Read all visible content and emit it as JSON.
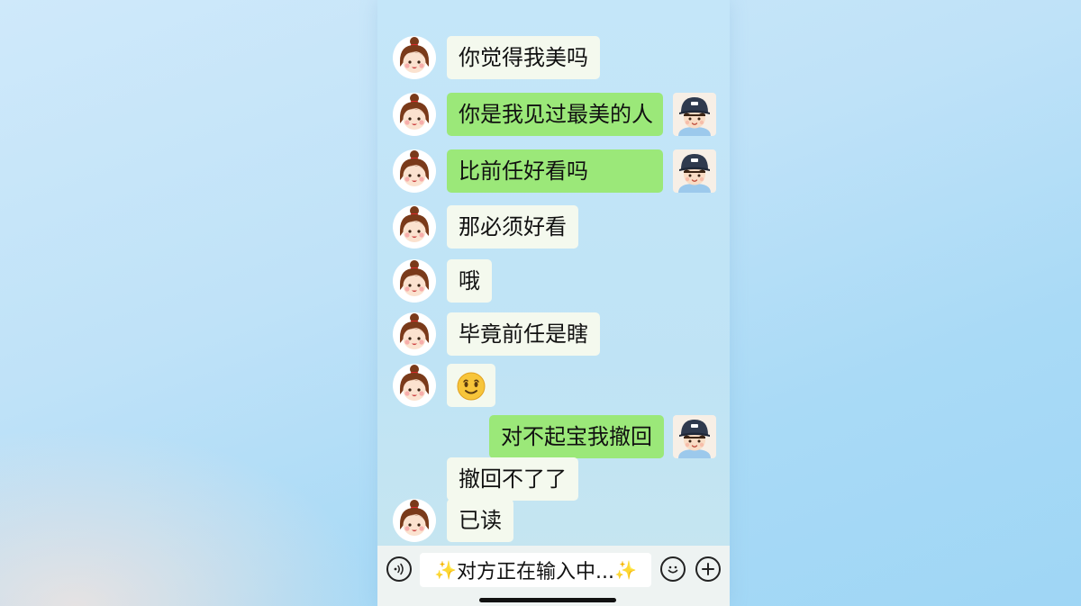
{
  "messages": [
    {
      "side": "left",
      "bubble": "white",
      "text": "你觉得我美吗",
      "avatar": "girl-avatar"
    },
    {
      "side": "right-with-left-avatar",
      "bubble": "green",
      "text": "你是我见过最美的人",
      "avatar": "boy-avatar"
    },
    {
      "side": "right-with-left-avatar",
      "bubble": "green",
      "text": "比前任好看吗",
      "avatar": "boy-avatar"
    },
    {
      "side": "left",
      "bubble": "white",
      "text": "那必须好看",
      "avatar": "girl-avatar"
    },
    {
      "side": "left",
      "bubble": "white",
      "text": "哦",
      "avatar": "girl-avatar"
    },
    {
      "side": "left",
      "bubble": "white",
      "text": "毕竟前任是瞎",
      "avatar": "girl-avatar"
    },
    {
      "side": "left",
      "bubble": "white",
      "text": "🫠",
      "avatar": "girl-avatar"
    },
    {
      "side": "right",
      "bubble": "green",
      "text": "对不起宝我撤回",
      "avatar": "boy-avatar"
    },
    {
      "side": "left",
      "bubble": "white",
      "text": "撤回不了了",
      "avatar": ""
    },
    {
      "side": "left",
      "bubble": "white",
      "text": "已读",
      "avatar": "girl-avatar"
    }
  ],
  "bottom_bar": {
    "input_text": "对方正在输入中...",
    "voice_icon": "voice-icon",
    "emoji_icon": "smile-icon",
    "plus_icon": "plus-icon"
  },
  "colors": {
    "green_bubble": "#9be879",
    "white_bubble": "#f4f9ee"
  }
}
